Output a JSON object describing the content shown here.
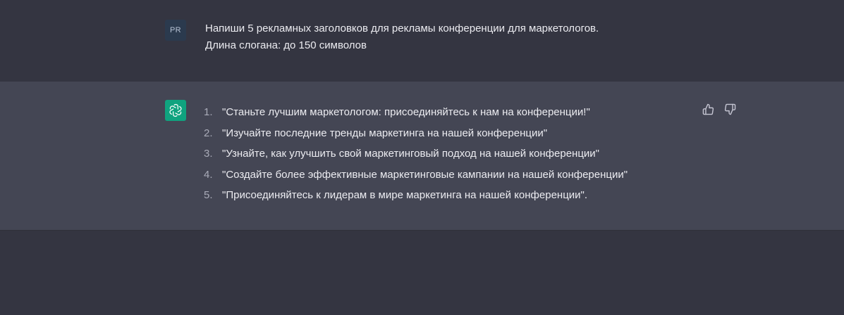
{
  "user_message": {
    "avatar_initials": "PR",
    "lines": [
      "Напиши 5 рекламных заголовков для рекламы конференции для маркетологов.",
      "Длина слогана: до 150 символов"
    ]
  },
  "assistant_message": {
    "avatar_icon": "openai-logo-icon",
    "items": [
      {
        "number": "1.",
        "text": "\"Станьте лучшим маркетологом: присоединяйтесь к нам на конференции!\""
      },
      {
        "number": "2.",
        "text": "\"Изучайте последние тренды маркетинга на нашей конференции\""
      },
      {
        "number": "3.",
        "text": "\"Узнайте, как улучшить свой маркетинговый подход на нашей конференции\""
      },
      {
        "number": "4.",
        "text": "\"Создайте более эффективные маркетинговые кампании на нашей конференции\""
      },
      {
        "number": "5.",
        "text": "\"Присоединяйтесь к лидерам в мире маркетинга на нашей конференции\"."
      }
    ],
    "feedback_icons": [
      "thumbs-up-icon",
      "thumbs-down-icon"
    ]
  },
  "colors": {
    "background": "#343541",
    "assistant_background": "#444654",
    "brand_green": "#10a37f",
    "user_avatar": "#2b3a4e"
  }
}
